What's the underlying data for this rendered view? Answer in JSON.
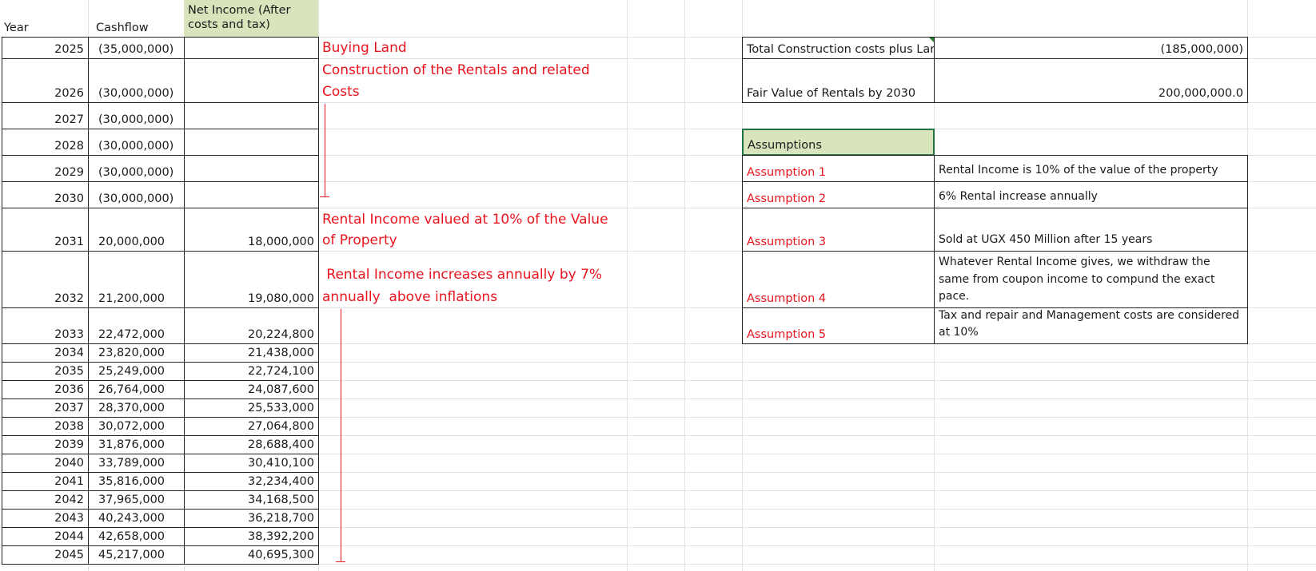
{
  "headers": {
    "year": "Year",
    "cashflow": "Cashflow",
    "net_income_line1": "Net Income (After",
    "net_income_line2": "costs and tax)"
  },
  "rows": [
    {
      "year": "2025",
      "cashflow": "(35,000,000)",
      "net": ""
    },
    {
      "year": "2026",
      "cashflow": "(30,000,000)",
      "net": ""
    },
    {
      "year": "2027",
      "cashflow": "(30,000,000)",
      "net": ""
    },
    {
      "year": "2028",
      "cashflow": "(30,000,000)",
      "net": ""
    },
    {
      "year": "2029",
      "cashflow": "(30,000,000)",
      "net": ""
    },
    {
      "year": "2030",
      "cashflow": "(30,000,000)",
      "net": ""
    },
    {
      "year": "2031",
      "cashflow": "20,000,000",
      "net": "18,000,000"
    },
    {
      "year": "2032",
      "cashflow": "21,200,000",
      "net": "19,080,000"
    },
    {
      "year": "2033",
      "cashflow": "22,472,000",
      "net": "20,224,800"
    },
    {
      "year": "2034",
      "cashflow": "23,820,000",
      "net": "21,438,000"
    },
    {
      "year": "2035",
      "cashflow": "25,249,000",
      "net": "22,724,100"
    },
    {
      "year": "2036",
      "cashflow": "26,764,000",
      "net": "24,087,600"
    },
    {
      "year": "2037",
      "cashflow": "28,370,000",
      "net": "25,533,000"
    },
    {
      "year": "2038",
      "cashflow": "30,072,000",
      "net": "27,064,800"
    },
    {
      "year": "2039",
      "cashflow": "31,876,000",
      "net": "28,688,400"
    },
    {
      "year": "2040",
      "cashflow": "33,789,000",
      "net": "30,410,100"
    },
    {
      "year": "2041",
      "cashflow": "35,816,000",
      "net": "32,234,400"
    },
    {
      "year": "2042",
      "cashflow": "37,965,000",
      "net": "34,168,500"
    },
    {
      "year": "2043",
      "cashflow": "40,243,000",
      "net": "36,218,700"
    },
    {
      "year": "2044",
      "cashflow": "42,658,000",
      "net": "38,392,200"
    },
    {
      "year": "2045",
      "cashflow": "45,217,000",
      "net": "40,695,300"
    }
  ],
  "notes": {
    "buying_land": "Buying Land",
    "construction_line1": "Construction of the Rentals and related",
    "construction_line2": "Costs",
    "rental_valued_line1": "Rental Income valued at 10% of the Value",
    "rental_valued_line2": "of Property",
    "rental_increase_line1": " Rental Income increases annually by 7%",
    "rental_increase_line2": "annually  above inflations"
  },
  "summary": {
    "total_label": "Total Construction costs plus Lar",
    "total_value": "(185,000,000)",
    "fair_label": "Fair Value of Rentals by 2030",
    "fair_value": "200,000,000.0"
  },
  "assumptions": {
    "header": "Assumptions",
    "items": [
      {
        "label": "Assumption 1",
        "text": "Rental Income is 10% of the value of the property"
      },
      {
        "label": "Assumption 2",
        "text": "6% Rental increase annually"
      },
      {
        "label": "Assumption 3",
        "text": "Sold at UGX 450 Million after 15 years"
      },
      {
        "label": "Assumption 4",
        "text": "Whatever Rental Income gives, we withdraw the same from coupon income to compund the exact pace."
      },
      {
        "label": "Assumption 5",
        "text": "Tax and repair and Management costs are considered at 10%"
      }
    ]
  },
  "colors": {
    "header_fill": "#d8e4bc",
    "annotation_red": "#e8141e",
    "selection_green": "#217346",
    "gridline": "#e2e2e2"
  }
}
